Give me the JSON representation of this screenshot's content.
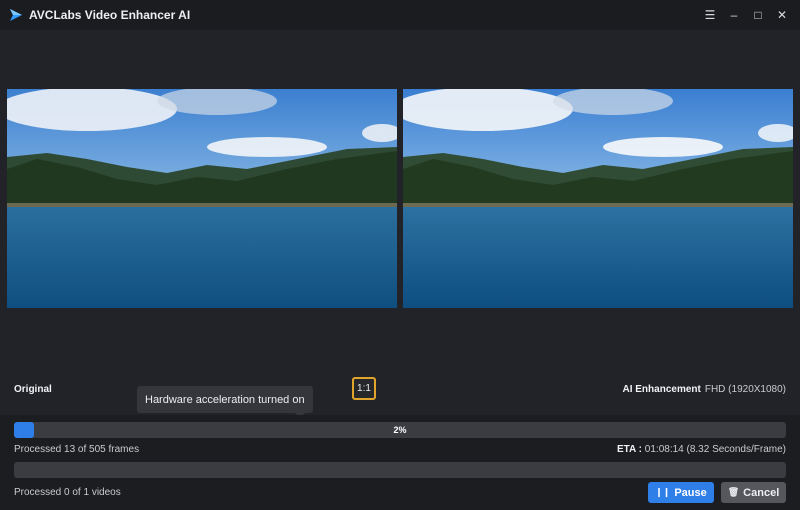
{
  "window": {
    "title": "AVCLabs Video Enhancer AI",
    "controls": [
      "menu-icon",
      "minimize-icon",
      "maximize-icon",
      "close-icon"
    ],
    "menu_glyph": "☰",
    "minimize_glyph": "–",
    "maximize_glyph": "□",
    "close_glyph": "✕"
  },
  "preview": {
    "left_label": "Original",
    "right_label": "AI Enhancement",
    "right_resolution": "FHD (1920X1080)",
    "ratio_button": "1:1",
    "tooltip": "Hardware acceleration turned on"
  },
  "progress": {
    "percent": 2,
    "percent_label": "2%",
    "frames_text": "Processed 13 of 505 frames",
    "eta_label": "ETA :",
    "eta_value": "01:08:14 (8.32 Seconds/Frame)",
    "videos_percent": 0,
    "videos_text": "Processed 0 of 1 videos"
  },
  "buttons": {
    "pause_label": "Pause",
    "pause_icon": "pause-icon",
    "pause_glyph": "❙❙",
    "cancel_label": "Cancel",
    "cancel_icon": "trash-icon",
    "cancel_glyph": "🗑"
  },
  "colors": {
    "accent": "#2f7fe8",
    "highlight_border": "#e2a52c",
    "background": "#1f2024"
  }
}
